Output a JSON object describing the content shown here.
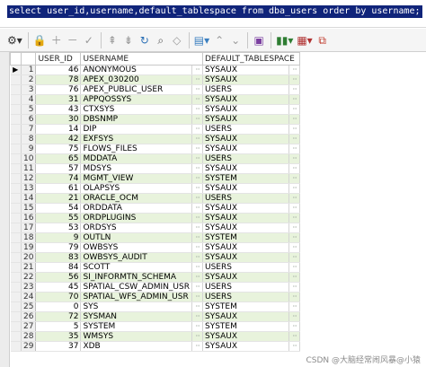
{
  "editor": {
    "sql": "select user_id,username,default_tablespace from dba_users order by username;"
  },
  "toolbar": {
    "icons": [
      "grid-menu",
      "lock",
      "add-row",
      "delete-row",
      "post",
      "first",
      "down-all",
      "refresh",
      "search",
      "eraser",
      "filter",
      "expand",
      "collapse",
      "save",
      "chart",
      "table-view",
      "export"
    ]
  },
  "grid": {
    "columns": [
      "USER_ID",
      "USERNAME",
      "DEFAULT_TABLESPACE"
    ],
    "current_row_marker": "▶",
    "cell_ellipsis": "···",
    "rows": [
      {
        "n": "1",
        "id": "46",
        "user": "ANONYMOUS",
        "ts": "SYSAUX"
      },
      {
        "n": "2",
        "id": "78",
        "user": "APEX_030200",
        "ts": "SYSAUX"
      },
      {
        "n": "3",
        "id": "76",
        "user": "APEX_PUBLIC_USER",
        "ts": "USERS"
      },
      {
        "n": "4",
        "id": "31",
        "user": "APPQOSSYS",
        "ts": "SYSAUX"
      },
      {
        "n": "5",
        "id": "43",
        "user": "CTXSYS",
        "ts": "SYSAUX"
      },
      {
        "n": "6",
        "id": "30",
        "user": "DBSNMP",
        "ts": "SYSAUX"
      },
      {
        "n": "7",
        "id": "14",
        "user": "DIP",
        "ts": "USERS"
      },
      {
        "n": "8",
        "id": "42",
        "user": "EXFSYS",
        "ts": "SYSAUX"
      },
      {
        "n": "9",
        "id": "75",
        "user": "FLOWS_FILES",
        "ts": "SYSAUX"
      },
      {
        "n": "10",
        "id": "65",
        "user": "MDDATA",
        "ts": "USERS"
      },
      {
        "n": "11",
        "id": "57",
        "user": "MDSYS",
        "ts": "SYSAUX"
      },
      {
        "n": "12",
        "id": "74",
        "user": "MGMT_VIEW",
        "ts": "SYSTEM"
      },
      {
        "n": "13",
        "id": "61",
        "user": "OLAPSYS",
        "ts": "SYSAUX"
      },
      {
        "n": "14",
        "id": "21",
        "user": "ORACLE_OCM",
        "ts": "USERS"
      },
      {
        "n": "15",
        "id": "54",
        "user": "ORDDATA",
        "ts": "SYSAUX"
      },
      {
        "n": "16",
        "id": "55",
        "user": "ORDPLUGINS",
        "ts": "SYSAUX"
      },
      {
        "n": "17",
        "id": "53",
        "user": "ORDSYS",
        "ts": "SYSAUX"
      },
      {
        "n": "18",
        "id": "9",
        "user": "OUTLN",
        "ts": "SYSTEM"
      },
      {
        "n": "19",
        "id": "79",
        "user": "OWBSYS",
        "ts": "SYSAUX"
      },
      {
        "n": "20",
        "id": "83",
        "user": "OWBSYS_AUDIT",
        "ts": "SYSAUX"
      },
      {
        "n": "21",
        "id": "84",
        "user": "SCOTT",
        "ts": "USERS"
      },
      {
        "n": "22",
        "id": "56",
        "user": "SI_INFORMTN_SCHEMA",
        "ts": "SYSAUX"
      },
      {
        "n": "23",
        "id": "45",
        "user": "SPATIAL_CSW_ADMIN_USR",
        "ts": "USERS"
      },
      {
        "n": "24",
        "id": "70",
        "user": "SPATIAL_WFS_ADMIN_USR",
        "ts": "USERS"
      },
      {
        "n": "25",
        "id": "0",
        "user": "SYS",
        "ts": "SYSTEM"
      },
      {
        "n": "26",
        "id": "72",
        "user": "SYSMAN",
        "ts": "SYSAUX"
      },
      {
        "n": "27",
        "id": "5",
        "user": "SYSTEM",
        "ts": "SYSTEM"
      },
      {
        "n": "28",
        "id": "35",
        "user": "WMSYS",
        "ts": "SYSAUX"
      },
      {
        "n": "29",
        "id": "37",
        "user": "XDB",
        "ts": "SYSAUX"
      }
    ]
  },
  "watermark": "CSDN @大脑经常闹风暴@小猿"
}
